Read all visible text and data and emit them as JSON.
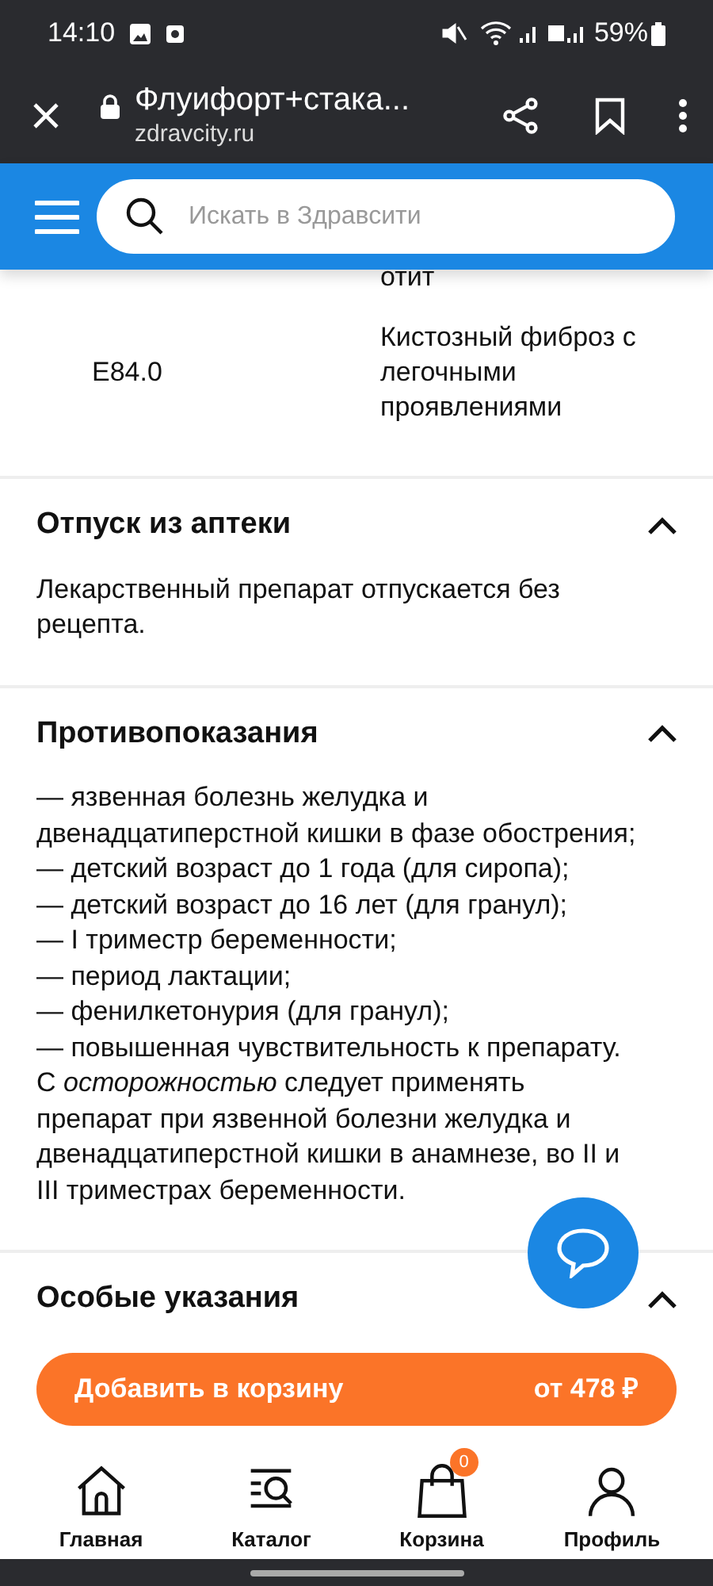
{
  "status_bar": {
    "time": "14:10",
    "battery": "59%"
  },
  "browser": {
    "title": "Флуифорт+стака...",
    "url": "zdravcity.ru"
  },
  "search": {
    "placeholder": "Искать в Здравсити"
  },
  "diagnosis_table": {
    "rows": [
      {
        "code": "",
        "name": "отит"
      },
      {
        "code": "E84.0",
        "name": "Кистозный фиброз с легочными проявлениями"
      }
    ]
  },
  "sections": [
    {
      "title": "Отпуск из аптеки",
      "expanded": true,
      "lines": [
        "Лекарственный препарат отпускается без рецепта."
      ]
    },
    {
      "title": "Противопоказания",
      "expanded": true,
      "lines": [
        "— язвенная болезнь желудка и двенадцатиперстной кишки в фазе обострения;",
        "— детский возраст до 1 года (для сиропа);",
        "— детский возраст до 16 лет (для гранул);",
        "— I триместр беременности;",
        "— период лактации;",
        "— фенилкетонурия (для гранул);",
        "— повышенная чувствительность к препарату.",
        "С *осторожностью* следует применять препарат при язвенной болезни желудка и двенадцатиперстной кишки в анамнезе, во II и III триместрах беременности."
      ]
    },
    {
      "title": "Особые указания",
      "expanded": true
    }
  ],
  "cart_button": {
    "label": "Добавить в корзину",
    "price": "от 478 ₽"
  },
  "bottom_nav": [
    {
      "kind": "home",
      "label": "Главная"
    },
    {
      "kind": "catalog",
      "label": "Каталог"
    },
    {
      "kind": "cart",
      "label": "Корзина",
      "badge": "0"
    },
    {
      "kind": "profile",
      "label": "Профиль"
    }
  ]
}
